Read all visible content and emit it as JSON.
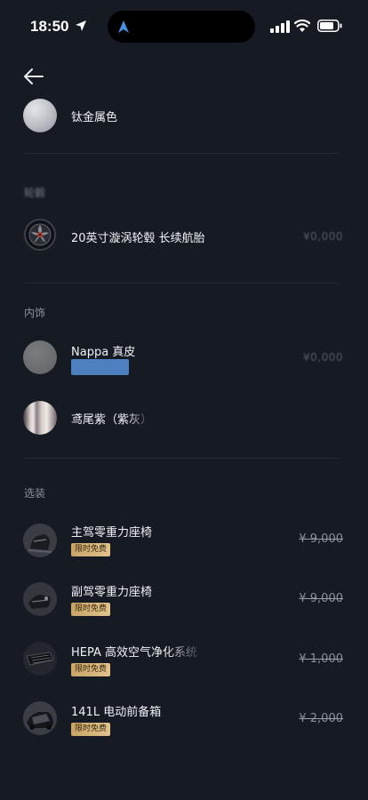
{
  "status_bar": {
    "time": "18:50"
  },
  "exterior": {
    "paint": {
      "label": "钛金属色",
      "swatch_color": "#b9bcc2"
    }
  },
  "wheels": {
    "section_label": "轮毂",
    "item": {
      "label": "20英寸漩涡轮毂 长续航胎",
      "price": "¥0,000"
    }
  },
  "interior": {
    "section_label": "内饰",
    "material": {
      "label": "Nappa 真皮",
      "price": "¥0,000",
      "swatch_color": "#6b6d71"
    },
    "color": {
      "label": "鸢尾紫（紫灰）"
    }
  },
  "options": {
    "section_label": "选装",
    "items": [
      {
        "label": "主驾零重力座椅",
        "badge": "限时免费",
        "price": "¥ 9,000"
      },
      {
        "label": "副驾零重力座椅",
        "badge": "限时免费",
        "price": "¥ 9,000"
      },
      {
        "label": "HEPA 高效空气净化系统",
        "badge": "限时免费",
        "price": "¥ 1,000"
      },
      {
        "label": "141L 电动前备箱",
        "badge": "限时免费",
        "price": "¥ 2,000"
      }
    ]
  },
  "colors": {
    "background": "#161a23",
    "badge_gold": "#d4b37a",
    "highlight_blue": "#4e7fbf"
  }
}
